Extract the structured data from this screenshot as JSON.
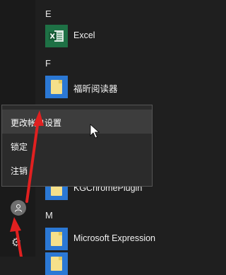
{
  "sections": [
    {
      "letter": "E"
    },
    {
      "letter": "F"
    },
    {
      "letter": "M"
    }
  ],
  "apps": [
    {
      "label": "Excel",
      "icon": "excel-icon",
      "tile_color": "#1e7145"
    },
    {
      "label": "福昕阅读器",
      "icon": "folder-icon",
      "tile_color": "#2b78d4"
    },
    {
      "label": "KGChromePlugin",
      "icon": "folder-icon",
      "tile_color": "#2b78d4"
    },
    {
      "label": "Microsoft Expression",
      "icon": "folder-icon",
      "tile_color": "#2b78d4"
    },
    {
      "label": "",
      "icon": "folder-icon",
      "tile_color": "#2b78d4"
    }
  ],
  "context_menu": {
    "items": [
      {
        "label": "更改帐户设置",
        "hovered": true
      },
      {
        "label": "锁定"
      },
      {
        "label": "注销"
      }
    ]
  },
  "rail": {
    "user_icon": "user-avatar-icon",
    "settings_icon": "gear-icon"
  },
  "annotations": {
    "arrow_color": "#e02020"
  },
  "colors": {
    "background": "#1f1f1f",
    "menu_background": "#2b2b2b",
    "menu_hover": "#3d3d3d"
  }
}
